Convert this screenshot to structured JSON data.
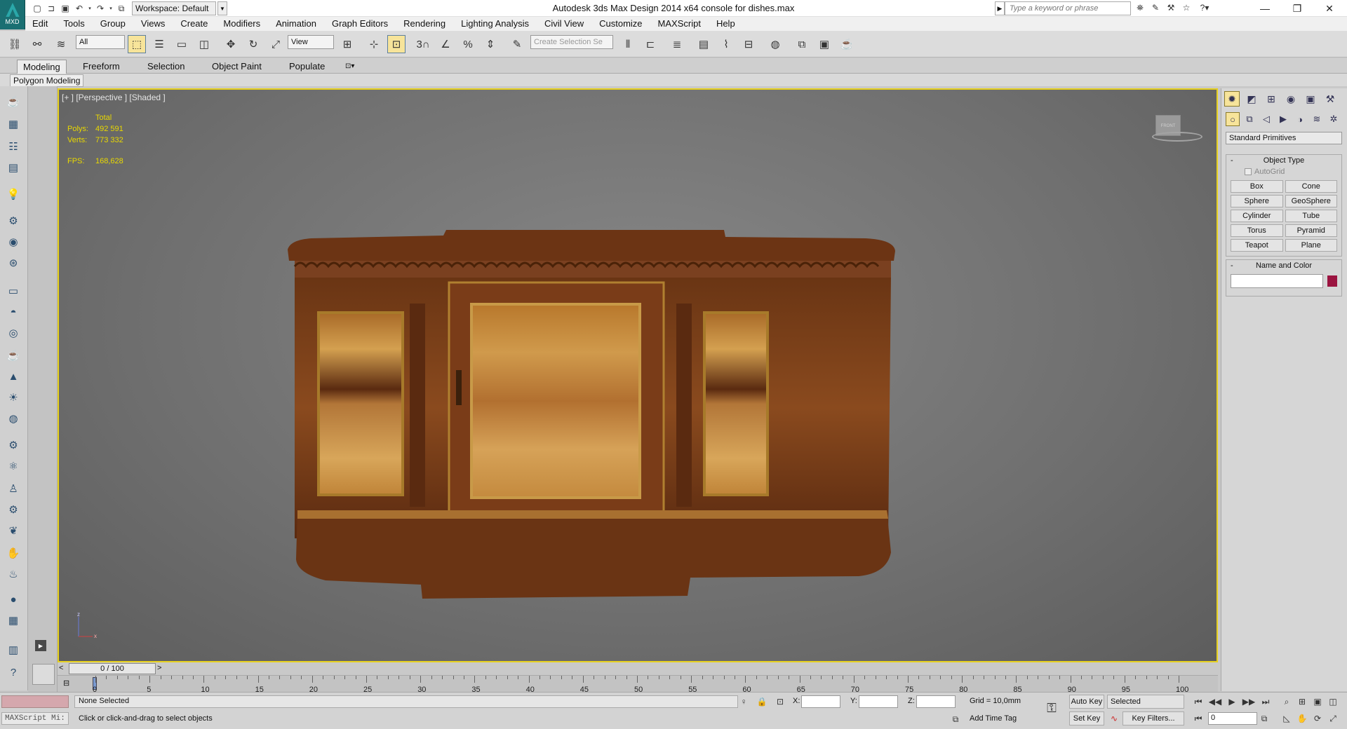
{
  "titlebar": {
    "app_title": "Autodesk 3ds Max Design 2014 x64      console for dishes.max",
    "workspace": "Workspace: Default",
    "search_placeholder": "Type a keyword or phrase",
    "logo_text": "MXD"
  },
  "menu": [
    "Edit",
    "Tools",
    "Group",
    "Views",
    "Create",
    "Modifiers",
    "Animation",
    "Graph Editors",
    "Rendering",
    "Lighting Analysis",
    "Civil View",
    "Customize",
    "MAXScript",
    "Help"
  ],
  "main_toolbar": {
    "filter_dropdown": "All",
    "reference_coord": "View",
    "selection_set_placeholder": "Create Selection Se",
    "snap_label": "3"
  },
  "ribbon": {
    "tabs": [
      "Modeling",
      "Freeform",
      "Selection",
      "Object Paint",
      "Populate"
    ],
    "active_tab": "Modeling",
    "panel_label": "Polygon Modeling"
  },
  "viewport": {
    "label": "[+ ] [Perspective ] [Shaded ]",
    "stats": {
      "header": "Total",
      "polys_label": "Polys:",
      "polys_value": "492 591",
      "verts_label": "Verts:",
      "verts_value": "773 332",
      "fps_label": "FPS:",
      "fps_value": "168,628"
    },
    "viewcube_label": "FRONT",
    "axis_z": "z",
    "axis_x": "x"
  },
  "timeline": {
    "slider_text": "0 / 100",
    "ticks": [
      "0",
      "5",
      "10",
      "15",
      "20",
      "25",
      "30",
      "35",
      "40",
      "45",
      "50",
      "55",
      "60",
      "65",
      "70",
      "75",
      "80",
      "85",
      "90",
      "95",
      "100"
    ]
  },
  "command_panel": {
    "category_dropdown": "Standard Primitives",
    "object_type_title": "Object Type",
    "autogrid_label": "AutoGrid",
    "primitives": [
      "Box",
      "Cone",
      "Sphere",
      "GeoSphere",
      "Cylinder",
      "Tube",
      "Torus",
      "Pyramid",
      "Teapot",
      "Plane"
    ],
    "name_color_title": "Name and Color",
    "rollout_toggle": "-",
    "object_color": "#9b1440"
  },
  "status": {
    "selection": "None Selected",
    "prompt": "Click or click-and-drag to select objects",
    "maxscript_placeholder": "MAXScript Mi:",
    "x_label": "X:",
    "y_label": "Y:",
    "z_label": "Z:",
    "grid": "Grid = 10,0mm",
    "add_time_tag": "Add Time Tag",
    "auto_key": "Auto Key",
    "set_key": "Set Key",
    "key_mode": "Selected",
    "key_filters": "Key Filters...",
    "frame_value": "0"
  }
}
